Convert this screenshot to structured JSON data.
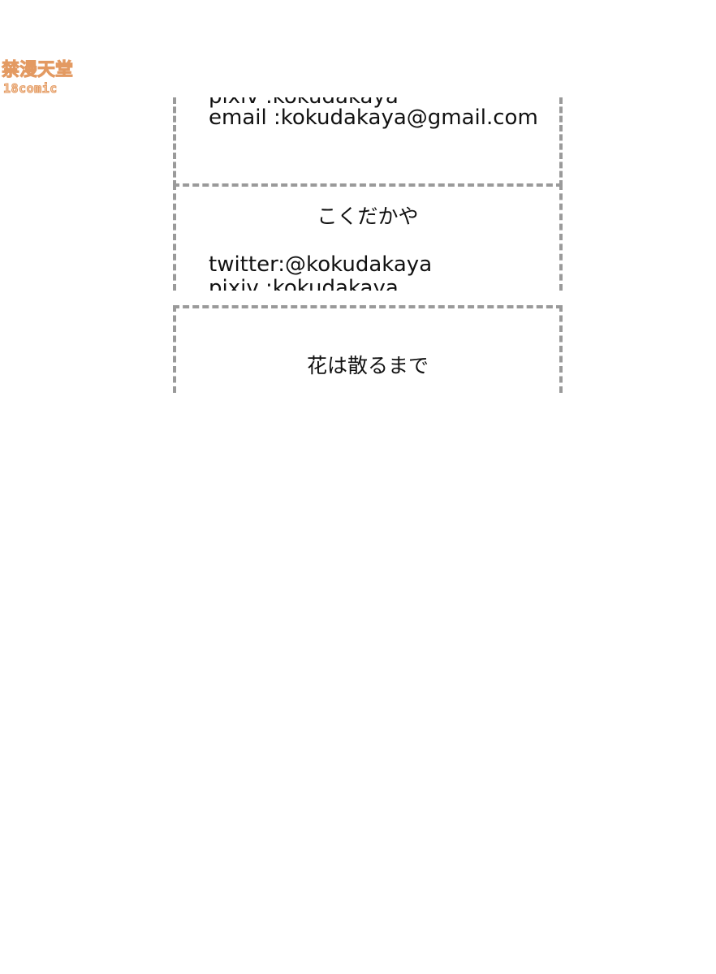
{
  "watermark": {
    "title": "禁漫天堂",
    "subtitle": "18comic"
  },
  "panel_1": {
    "pixiv_line": "pixiv :kokudakaya",
    "email_line": "email :kokudakaya@gmail.com"
  },
  "panel_2": {
    "author": "こくだかや",
    "twitter_line": "twitter:@kokudakaya",
    "pixiv_line": "pixiv :kokudakaya"
  },
  "panel_3": {
    "title": "花は散るまで"
  }
}
